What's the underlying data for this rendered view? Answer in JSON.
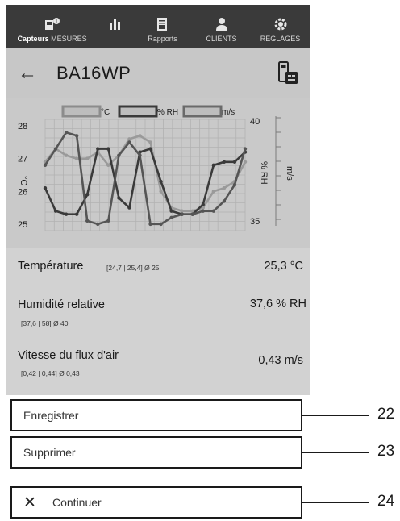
{
  "nav": {
    "items": [
      {
        "label_a": "Capteurs",
        "label_b": "MESURES",
        "icon": "sensors-icon"
      },
      {
        "label": "",
        "icon": "bar-chart-icon"
      },
      {
        "label": "Rapports",
        "icon": "report-icon"
      },
      {
        "label": "CLIENTS",
        "icon": "clients-icon"
      },
      {
        "label": "RÉGLAGES",
        "icon": "gear-icon"
      }
    ],
    "colors": {
      "bg": "#3a3a3a",
      "text": "#d8d8d8"
    }
  },
  "header": {
    "back_icon": "arrow-left-icon",
    "title": "BA16WP",
    "device_icon": "device-icon"
  },
  "chart_data": {
    "type": "line",
    "legend": [
      {
        "name": "°C",
        "color": "#8c8c8c"
      },
      {
        "name": "% RH",
        "color": "#3a3a3a"
      },
      {
        "name": "m/s",
        "color": "#6a6a6a"
      }
    ],
    "legend_position": "top",
    "y_left": {
      "label": "°C",
      "ticks": [
        "28",
        "27",
        "26",
        "25"
      ],
      "range": [
        24.8,
        28.2
      ]
    },
    "y_right": {
      "label": "% RH",
      "ticks": [
        "40",
        "35"
      ],
      "range": [
        34.5,
        40.5
      ]
    },
    "y_right2": {
      "label": "m/s"
    },
    "grid": true,
    "series": [
      {
        "name": "°C",
        "color": "#9a9a9a",
        "unit_axis": "left",
        "values": [
          26.9,
          27.3,
          27.1,
          27.0,
          27.0,
          27.2,
          26.8,
          27.1,
          27.6,
          27.7,
          27.5,
          26.0,
          25.5,
          25.4,
          25.4,
          25.5,
          26.0,
          26.1,
          26.3,
          26.9
        ]
      },
      {
        "name": "% RH",
        "color": "#3a3a3a",
        "unit_axis": "left",
        "values": [
          26.1,
          25.4,
          25.3,
          25.3,
          25.9,
          27.3,
          27.3,
          25.8,
          25.5,
          27.2,
          27.3,
          26.3,
          25.4,
          25.3,
          25.3,
          25.6,
          26.8,
          26.9,
          26.9,
          27.2
        ]
      },
      {
        "name": "m/s",
        "color": "#555555",
        "unit_axis": "left",
        "values": [
          26.8,
          27.3,
          27.8,
          27.7,
          25.1,
          25.0,
          25.1,
          27.1,
          27.5,
          27.1,
          25.0,
          25.0,
          25.2,
          25.3,
          25.3,
          25.4,
          25.4,
          25.7,
          26.2,
          27.3
        ]
      }
    ]
  },
  "readings": [
    {
      "name": "Température",
      "stats": "[24,7 | 25,4]   Ø 25",
      "value": "25,3 °C"
    },
    {
      "name": "Humidité relative",
      "stats": "[37,6 | 58]   Ø 40",
      "value": "37,6 % RH"
    },
    {
      "name": "Vitesse du flux d'air",
      "stats": "[0,42 | 0,44]   Ø 0,43",
      "value": "0,43 m/s"
    }
  ],
  "actions": [
    {
      "label": "Enregistrer",
      "callout": "22"
    },
    {
      "label": "Supprimer",
      "callout": "23"
    },
    {
      "label": "Continuer",
      "callout": "24",
      "icon": "close-icon"
    }
  ]
}
